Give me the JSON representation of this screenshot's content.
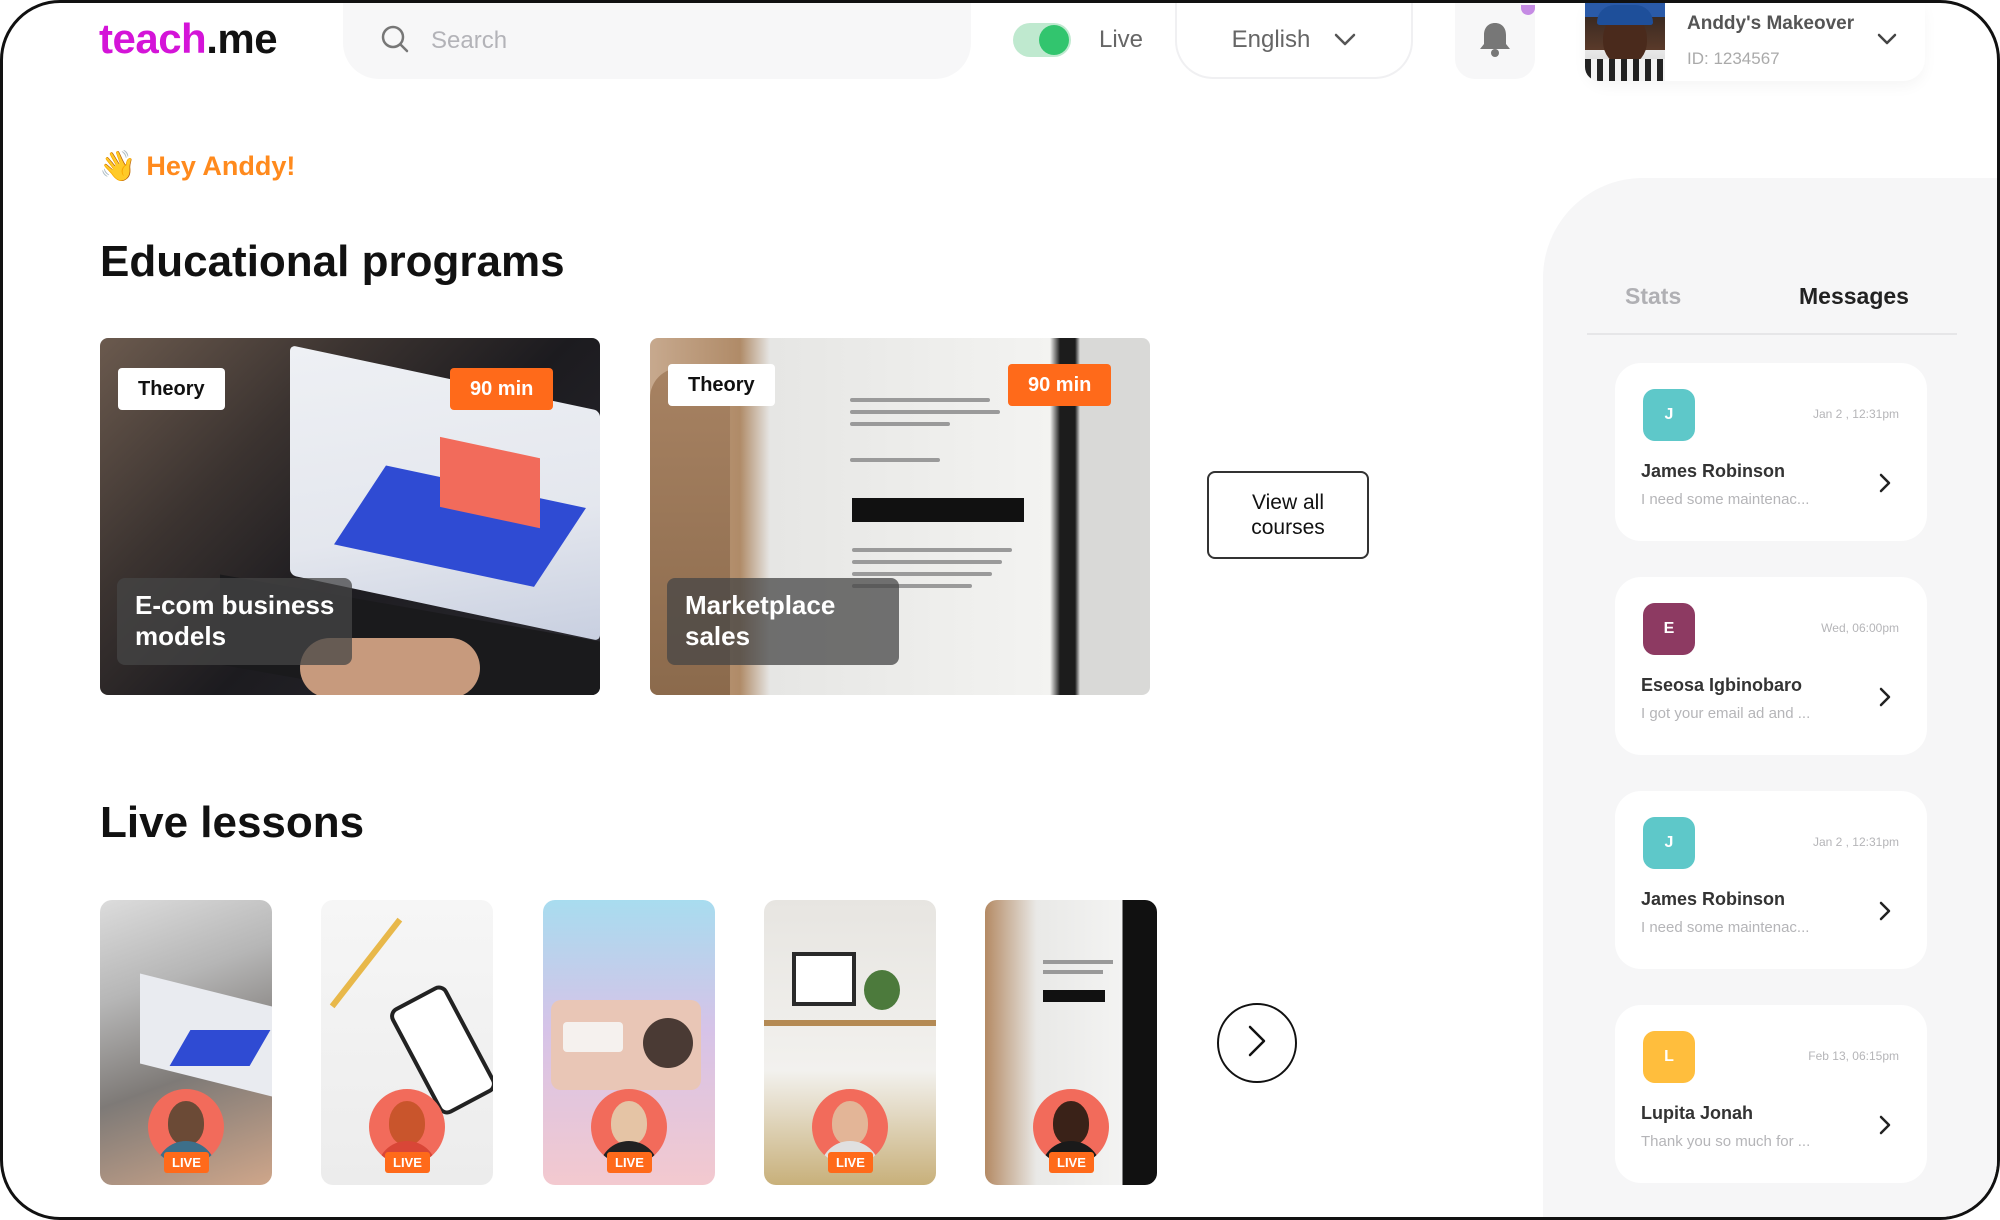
{
  "brand": {
    "part1": "teach",
    "dot": ".",
    "part2": "me"
  },
  "search": {
    "placeholder": "Search",
    "value": ""
  },
  "live_toggle": {
    "label": "Live",
    "on": true
  },
  "language": {
    "selected": "English"
  },
  "profile": {
    "name": "Anddy's Makeover",
    "id": "ID: 1234567"
  },
  "greeting": {
    "emoji": "👋",
    "text": "Hey Anddy!"
  },
  "educational": {
    "heading": "Educational programs",
    "courses": [
      {
        "tag": "Theory",
        "duration": "90 min",
        "title_line1": "E-com business",
        "title_line2": "models"
      },
      {
        "tag": "Theory",
        "duration": "90 min",
        "title_line1": "Marketplace",
        "title_line2": "sales"
      }
    ],
    "view_all_line1": "View all",
    "view_all_line2": "courses"
  },
  "live": {
    "heading": "Live lessons",
    "lessons": [
      {
        "tag": "LIVE"
      },
      {
        "tag": "LIVE"
      },
      {
        "tag": "LIVE"
      },
      {
        "tag": "LIVE"
      },
      {
        "tag": "LIVE"
      }
    ]
  },
  "sidebar": {
    "tabs": [
      {
        "label": "Stats",
        "active": false
      },
      {
        "label": "Messages",
        "active": true
      }
    ],
    "messages": [
      {
        "initial": "J",
        "color": "#5ec8c9",
        "time": "Jan 2 , 12:31pm",
        "name": "James Robinson",
        "preview": "I need some maintenac..."
      },
      {
        "initial": "E",
        "color": "#8d3a62",
        "time": "Wed, 06:00pm",
        "name": "Eseosa Igbinobaro",
        "preview": "I got your email ad and ..."
      },
      {
        "initial": "J",
        "color": "#5ec8c9",
        "time": "Jan 2 , 12:31pm",
        "name": "James Robinson",
        "preview": "I need some maintenac..."
      },
      {
        "initial": "L",
        "color": "#ffbe3d",
        "time": "Feb 13, 06:15pm",
        "name": "Lupita Jonah",
        "preview": "Thank you so much for ..."
      }
    ]
  },
  "colors": {
    "brand": "#d414d8",
    "accent_orange": "#ff6a1a",
    "greeting": "#ff8a1d",
    "toggle_on": "#32c56e"
  }
}
